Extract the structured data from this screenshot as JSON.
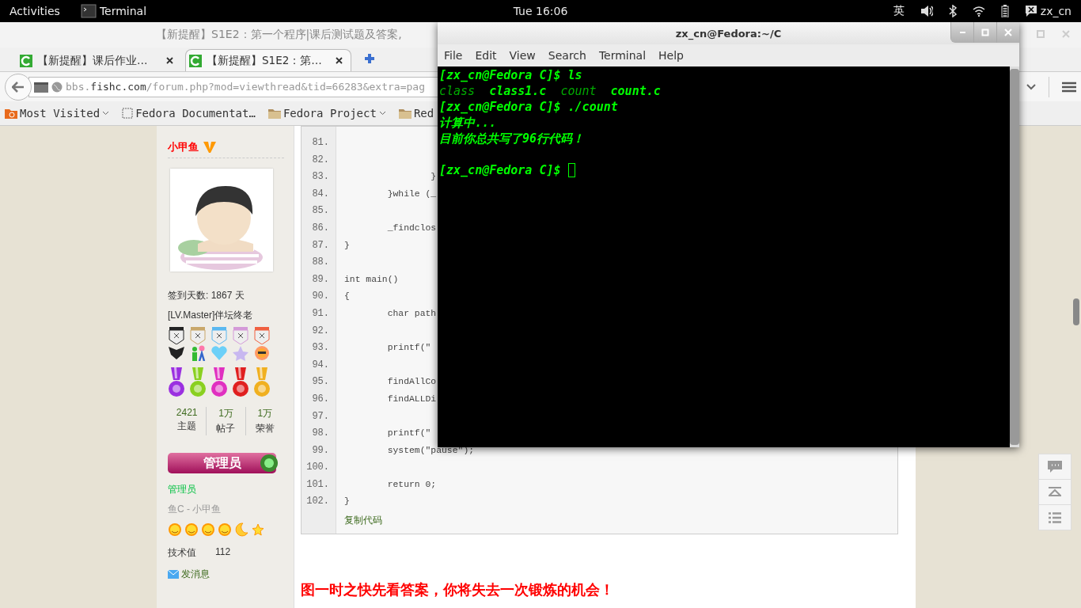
{
  "top_bar": {
    "activities": "Activities",
    "app": "Terminal",
    "clock": "Tue 16:06",
    "input_method": "英",
    "user": "zx_cn"
  },
  "browser": {
    "title": "【新提醒】S1E2：第一个程序|课后测试题及答案,",
    "tabs": [
      {
        "label": "【新提醒】课后作业…",
        "selected": false
      },
      {
        "label": "【新提醒】S1E2：第…",
        "selected": true
      }
    ],
    "url": {
      "scheme_host": "bbs.",
      "domain": "fishc.com",
      "path": "/forum.php?mod=viewthread&tid=66283&extra=pag"
    },
    "bookmarks": [
      {
        "label": "Most Visited",
        "kind": "smart"
      },
      {
        "label": "Fedora Documentat…",
        "kind": "page"
      },
      {
        "label": "Fedora Project",
        "kind": "folder"
      },
      {
        "label": "Red",
        "kind": "folder"
      }
    ]
  },
  "author": {
    "name": "小甲鱼",
    "checkin": "签到天数: 1867 天",
    "level": "[LV.Master]伴坛终老",
    "stats": [
      {
        "value": "2421",
        "label": "主题"
      },
      {
        "value": "1万",
        "label": "帖子"
      },
      {
        "value": "1万",
        "label": "荣誉"
      }
    ],
    "role_banner": "管理员",
    "group": "管理员",
    "title": "鱼C - 小甲鱼",
    "skill_label": "技术值",
    "skill_value": "112",
    "message": "发消息"
  },
  "code": {
    "lines": [
      {
        "number": "81."
      },
      {
        "number": "82."
      },
      {
        "number": "83.",
        "text": "                }"
      },
      {
        "number": "84.",
        "text": "        }while (_"
      },
      {
        "number": "85."
      },
      {
        "number": "86.",
        "text": "        _findclos"
      },
      {
        "number": "87.",
        "text": "}"
      },
      {
        "number": "88."
      },
      {
        "number": "89.",
        "text": "int main()"
      },
      {
        "number": "90.",
        "text": "{"
      },
      {
        "number": "91.",
        "text": "        char path"
      },
      {
        "number": "92."
      },
      {
        "number": "93.",
        "text": "        printf(\""
      },
      {
        "number": "94."
      },
      {
        "number": "95.",
        "text": "        findAllCo"
      },
      {
        "number": "96.",
        "text": "        findALLDi"
      },
      {
        "number": "97."
      },
      {
        "number": "98.",
        "text": "        printf(\""
      },
      {
        "number": "99.",
        "text": "        system(\"pause\");"
      },
      {
        "number": "100."
      },
      {
        "number": "101.",
        "text": "        return 0;"
      },
      {
        "number": "102.",
        "text": "}"
      }
    ],
    "copy": "复制代码"
  },
  "notice": "图一时之快先看答案，你将失去一次锻炼的机会！",
  "terminal": {
    "title": "zx_cn@Fedora:~/C",
    "menu": [
      "File",
      "Edit",
      "View",
      "Search",
      "Terminal",
      "Help"
    ],
    "lines": [
      {
        "kind": "text",
        "text": "[zx_cn@Fedora C]$ ls"
      },
      {
        "kind": "files",
        "files": [
          {
            "name": "class",
            "bold": false
          },
          {
            "name": "class1.c",
            "bold": true
          },
          {
            "name": "count",
            "bold": false
          },
          {
            "name": "count.c",
            "bold": true
          }
        ]
      },
      {
        "kind": "text",
        "text": "[zx_cn@Fedora C]$ ./count"
      },
      {
        "kind": "text",
        "text": "计算中..."
      },
      {
        "kind": "text",
        "text": "目前你总共写了96行代码！"
      },
      {
        "kind": "blank"
      },
      {
        "kind": "prompt",
        "text": "[zx_cn@Fedora C]$",
        "cursor": true
      }
    ]
  }
}
